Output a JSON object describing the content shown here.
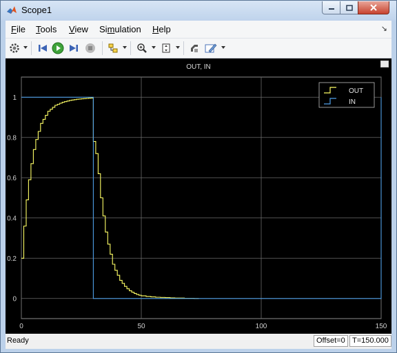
{
  "window": {
    "title": "Scope1",
    "icon": "matlab-logo-icon",
    "controls": [
      "minimize-icon",
      "maximize-icon",
      "close-icon"
    ]
  },
  "menu": {
    "items": [
      {
        "label": "File",
        "mnemonic": "F"
      },
      {
        "label": "Tools",
        "mnemonic": "T"
      },
      {
        "label": "View",
        "mnemonic": "V"
      },
      {
        "label": "Simulation",
        "mnemonic": "m"
      },
      {
        "label": "Help",
        "mnemonic": "H"
      }
    ]
  },
  "toolbar": {
    "icons": [
      "parameters-gear-icon",
      "step-back-icon",
      "run-icon",
      "step-forward-icon",
      "stop-icon",
      "highlight-simulink-block-icon",
      "zoom-in-icon",
      "fit-to-view-icon",
      "style-icon",
      "edit-legend-icon"
    ]
  },
  "plot": {
    "title": "OUT, IN",
    "background": "#000000",
    "grid_color": "#6b6b6b",
    "axes_color": "#8c8c8c"
  },
  "chart_data": {
    "type": "line",
    "title": "OUT, IN",
    "xlabel": "",
    "ylabel": "",
    "xlim": [
      0,
      150
    ],
    "ylim": [
      -0.1,
      1.1
    ],
    "xticks": [
      0,
      50,
      100,
      150
    ],
    "yticks": [
      0,
      0.2,
      0.4,
      0.6,
      0.8,
      1
    ],
    "grid": true,
    "legend_position": "top-right",
    "series": [
      {
        "name": "OUT",
        "color": "#ffff66",
        "style": "stairs",
        "x": [
          0,
          1,
          2,
          3,
          4,
          5,
          6,
          7,
          8,
          9,
          10,
          11,
          12,
          13,
          14,
          15,
          16,
          17,
          18,
          19,
          20,
          21,
          22,
          23,
          24,
          25,
          26,
          27,
          28,
          29,
          30,
          31,
          32,
          33,
          34,
          35,
          36,
          37,
          38,
          39,
          40,
          41,
          42,
          43,
          44,
          45,
          46,
          47,
          48,
          49,
          50,
          52,
          54,
          56,
          58,
          60,
          62,
          64,
          66,
          68,
          70,
          72,
          74
        ],
        "y": [
          0.2,
          0.36,
          0.49,
          0.59,
          0.67,
          0.74,
          0.79,
          0.83,
          0.87,
          0.89,
          0.91,
          0.93,
          0.94,
          0.95,
          0.96,
          0.965,
          0.97,
          0.975,
          0.978,
          0.981,
          0.984,
          0.986,
          0.988,
          0.99,
          0.991,
          0.992,
          0.993,
          0.994,
          0.995,
          0.996,
          0.78,
          0.72,
          0.62,
          0.5,
          0.41,
          0.33,
          0.27,
          0.22,
          0.17,
          0.14,
          0.115,
          0.09,
          0.075,
          0.06,
          0.048,
          0.038,
          0.031,
          0.025,
          0.02,
          0.016,
          0.013,
          0.01,
          0.008,
          0.006,
          0.005,
          0.004,
          0.003,
          0.002,
          0.002,
          0.001,
          0.001,
          0.0,
          0.0
        ]
      },
      {
        "name": "IN",
        "color": "#4f9fe8",
        "style": "stairs",
        "x": [
          0,
          30,
          30,
          150,
          150
        ],
        "y": [
          1,
          1,
          0,
          0,
          1
        ]
      }
    ]
  },
  "status": {
    "text": "Ready",
    "offset": "Offset=0",
    "time": "T=150.000"
  }
}
